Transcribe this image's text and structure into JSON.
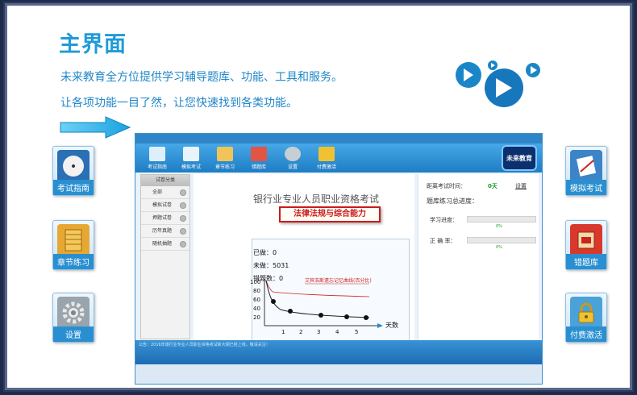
{
  "page": {
    "title": "主界面",
    "desc_line1": "未来教育全方位提供学习辅导题库、功能、工具和服务。",
    "desc_line2": "让各项功能一目了然，让您快速找到各类功能。"
  },
  "side_left": [
    {
      "label": "考试指南",
      "icon": "compass-icon"
    },
    {
      "label": "章节练习",
      "icon": "notebook-icon"
    },
    {
      "label": "设置",
      "icon": "gear-icon"
    }
  ],
  "side_right": [
    {
      "label": "模拟考试",
      "icon": "exam-paper-icon"
    },
    {
      "label": "错题库",
      "icon": "wrong-book-icon"
    },
    {
      "label": "付费激活",
      "icon": "lock-icon"
    }
  ],
  "app": {
    "toolbar": [
      "考试指南",
      "模拟考试",
      "章节练习",
      "错题库",
      "设置",
      "付费激活"
    ],
    "brand": "未来教育",
    "left_panel": {
      "header": "试卷分类",
      "items": [
        "全部",
        "模拟试卷",
        "押题试卷",
        "历年真题",
        "随机抽题"
      ]
    },
    "exam_title": "银行业专业人员职业资格考试",
    "subject": "法律法规与综合能力",
    "stats": {
      "done": "已做：0",
      "undone": "未做：5031",
      "wrong": "错题数：0"
    },
    "chart": {
      "legend": "艾宾浩斯遗忘记忆曲线(百分比)",
      "x_label": "天数",
      "y_ticks": [
        "100",
        "80",
        "60",
        "40",
        "20"
      ],
      "x_ticks": [
        "1",
        "2",
        "3",
        "4",
        "5"
      ]
    },
    "right": {
      "countdown_label": "距离考试时间：",
      "countdown_value": "0天",
      "countdown_link": "设置",
      "progress_title": "题库练习总进度：",
      "study_label": "学习进度：",
      "study_value": "0%",
      "accuracy_label": "正 确 率：",
      "accuracy_value": "0%"
    },
    "footer_notice": "公告：2016年银行业专业人员职业资格考试新大纲已经上线，敬请关注！"
  },
  "colors": {
    "accent": "#1f9bd6",
    "toolbar": "#2e86c9",
    "red": "#cc1a1a"
  }
}
